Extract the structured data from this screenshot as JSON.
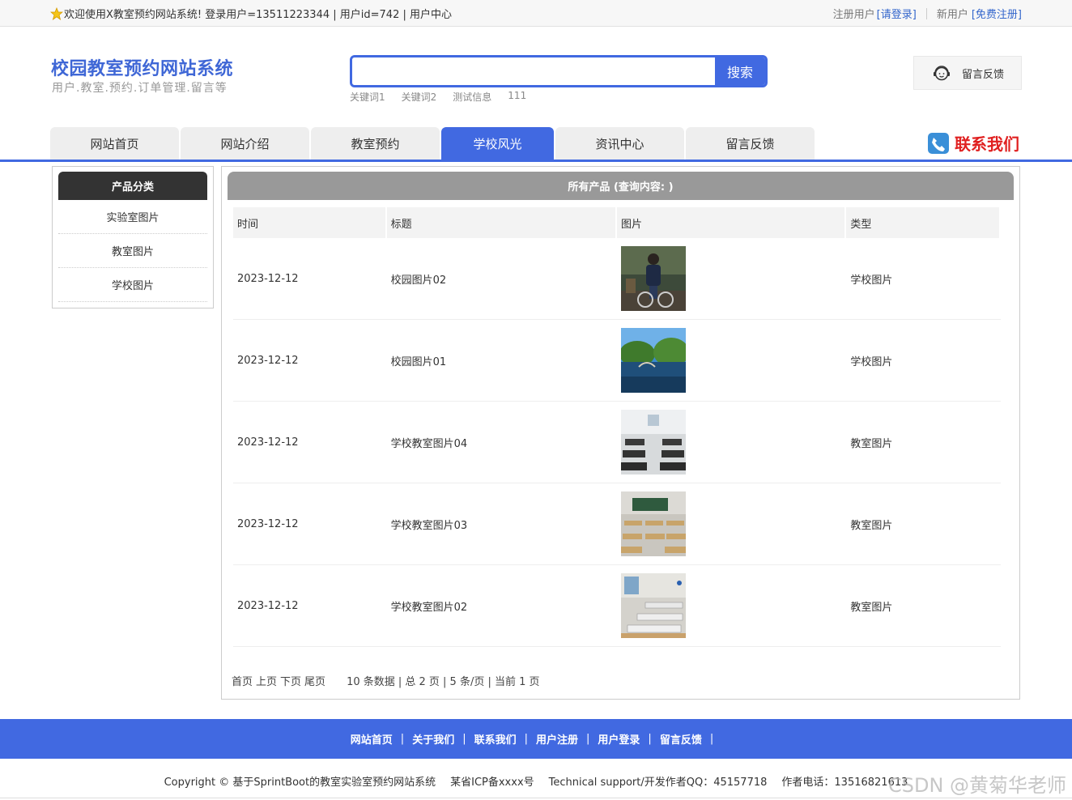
{
  "topbar": {
    "welcome": "欢迎使用X教室预约网站系统! 登录用户=13511223344 | 用户id=742 | 用户中心",
    "register_label": "注册用户",
    "login_link": "[请登录]",
    "new_user_label": "新用户",
    "signup_link": "[免费注册]"
  },
  "header": {
    "title": "校园教室预约网站系统",
    "subtitle": "用户.教室.预约.订单管理.留言等",
    "search_button": "搜索",
    "search_value": "",
    "keywords": [
      "关键词1",
      "关键词2",
      "测试信息",
      "111"
    ],
    "feedback_label": "留言反馈"
  },
  "nav": {
    "tabs": [
      "网站首页",
      "网站介绍",
      "教室预约",
      "学校风光",
      "资讯中心",
      "留言反馈"
    ],
    "active": "学校风光",
    "contact_label": "联系我们"
  },
  "sidebar": {
    "title": "产品分类",
    "items": [
      "实验室图片",
      "教室图片",
      "学校图片"
    ]
  },
  "main": {
    "title": "所有产品 (查询内容: )",
    "columns": [
      "时间",
      "标题",
      "图片",
      "类型"
    ],
    "rows": [
      {
        "time": "2023-12-12",
        "title": "校园图片02",
        "type": "学校图片",
        "image": "person-on-bicycle"
      },
      {
        "time": "2023-12-12",
        "title": "校园图片01",
        "type": "学校图片",
        "image": "campus-lake-bridge"
      },
      {
        "time": "2023-12-12",
        "title": "学校教室图片04",
        "type": "教室图片",
        "image": "classroom-desks"
      },
      {
        "time": "2023-12-12",
        "title": "学校教室图片03",
        "type": "教室图片",
        "image": "classroom-blackboard"
      },
      {
        "time": "2023-12-12",
        "title": "学校教室图片02",
        "type": "教室图片",
        "image": "classroom-window"
      }
    ]
  },
  "pager": {
    "first": "首页",
    "prev": "上页",
    "next": "下页",
    "last": "尾页",
    "info": "10 条数据 | 总 2 页 | 5 条/页 | 当前 1 页"
  },
  "footer": {
    "links": [
      "网站首页",
      "关于我们",
      "联系我们",
      "用户注册",
      "用户登录",
      "留言反馈"
    ],
    "separator": "|",
    "copyright": "Copyright © 基于SprintBoot的教室实验室预约网站系统",
    "icp": "某省ICP备xxxx号",
    "support": "Technical support/开发作者QQ：45157718",
    "phone": "作者电话：13516821613"
  },
  "watermark": "CSDN @黄菊华老师",
  "colors": {
    "accent": "#4169e1",
    "title": "#3f67d6",
    "contact": "#e02020",
    "sidebar_head": "#333333",
    "panel_head": "#999999"
  }
}
